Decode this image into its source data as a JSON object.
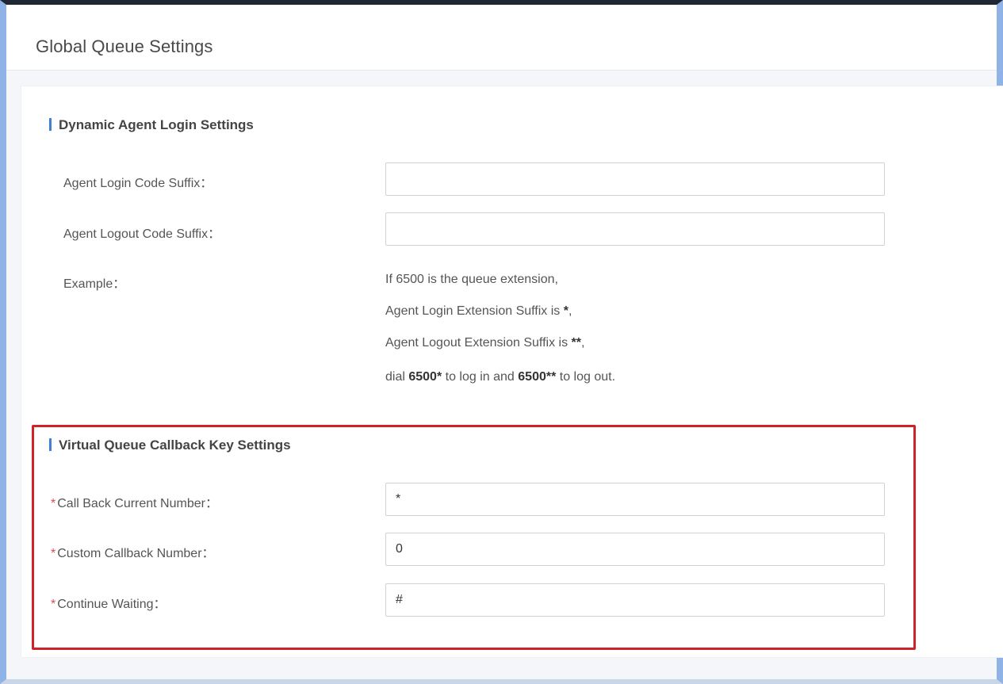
{
  "header": {
    "title": "Global Queue Settings"
  },
  "dynamic_agent": {
    "title": "Dynamic Agent Login Settings",
    "login_suffix_label": "Agent Login Code Suffix：",
    "login_suffix_value": "",
    "logout_suffix_label": "Agent Logout Code Suffix：",
    "logout_suffix_value": "",
    "example_label": "Example：",
    "example": {
      "line1": "If 6500 is the queue extension,",
      "line2_pre": "Agent Login Extension Suffix is ",
      "line2_bold": "*",
      "line2_post": ",",
      "line3_pre": "Agent Logout Extension Suffix is ",
      "line3_bold": "**",
      "line3_post": ",",
      "line4_pre": "dial ",
      "line4_bold1": "6500*",
      "line4_mid": " to log in and ",
      "line4_bold2": "6500**",
      "line4_post": " to log out."
    }
  },
  "virtual_queue": {
    "title": "Virtual Queue Callback Key Settings",
    "required_mark": "*",
    "callback_current_label": "Call Back Current Number：",
    "callback_current_value": "*",
    "custom_callback_label": "Custom Callback Number：",
    "custom_callback_value": "0",
    "continue_waiting_label": "Continue Waiting：",
    "continue_waiting_value": "#"
  },
  "colors": {
    "accent_bar": "#3f7fd8",
    "required": "#e04b4b",
    "highlight": "#d0222a"
  }
}
